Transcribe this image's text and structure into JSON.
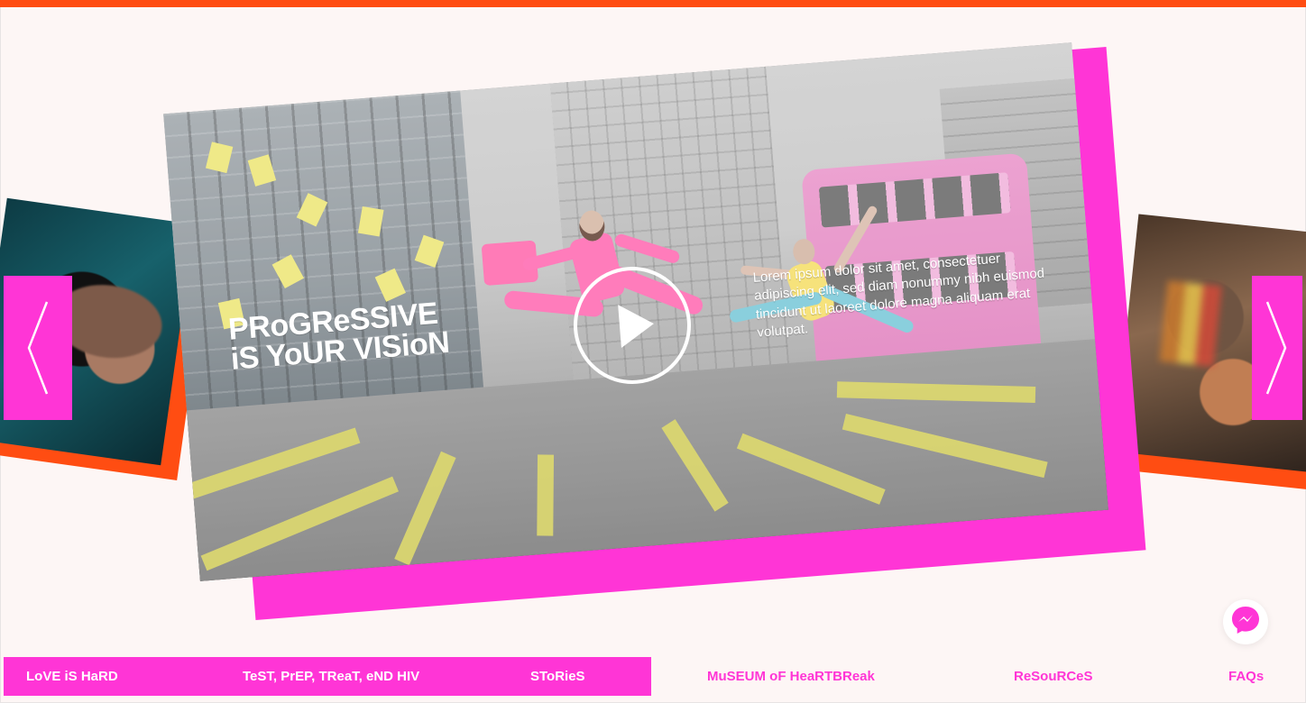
{
  "top_bar": {
    "color": "#ff4d12"
  },
  "carousel": {
    "prev_icon": "chevron-left-icon",
    "next_icon": "chevron-right-icon",
    "main_slide": {
      "headline_line1": "PRoGReSSIVE",
      "headline_line2": "iS YoUR VISioN",
      "description": "Lorem ipsum dolor sit amet, consectetuer adipiscing elit, sed diam nonummy nibh euismod tincidunt ut laoreet dolore magna aliquam erat volutpat.",
      "play_icon": "play-icon",
      "accent_color": "#ff35d6",
      "shadow_color": "#ff35d6"
    }
  },
  "floating_action": {
    "icon": "messenger-icon"
  },
  "footer_nav": {
    "items": [
      "LoVE iS HaRD",
      "TeST, PrEP, TReaT, eND HIV",
      "SToRieS",
      "MuSEUM oF HeaRTBReak",
      "ReSouRCeS",
      "FAQs"
    ],
    "active_bg": "#ff35d6",
    "inactive_text": "#ff35d6"
  }
}
